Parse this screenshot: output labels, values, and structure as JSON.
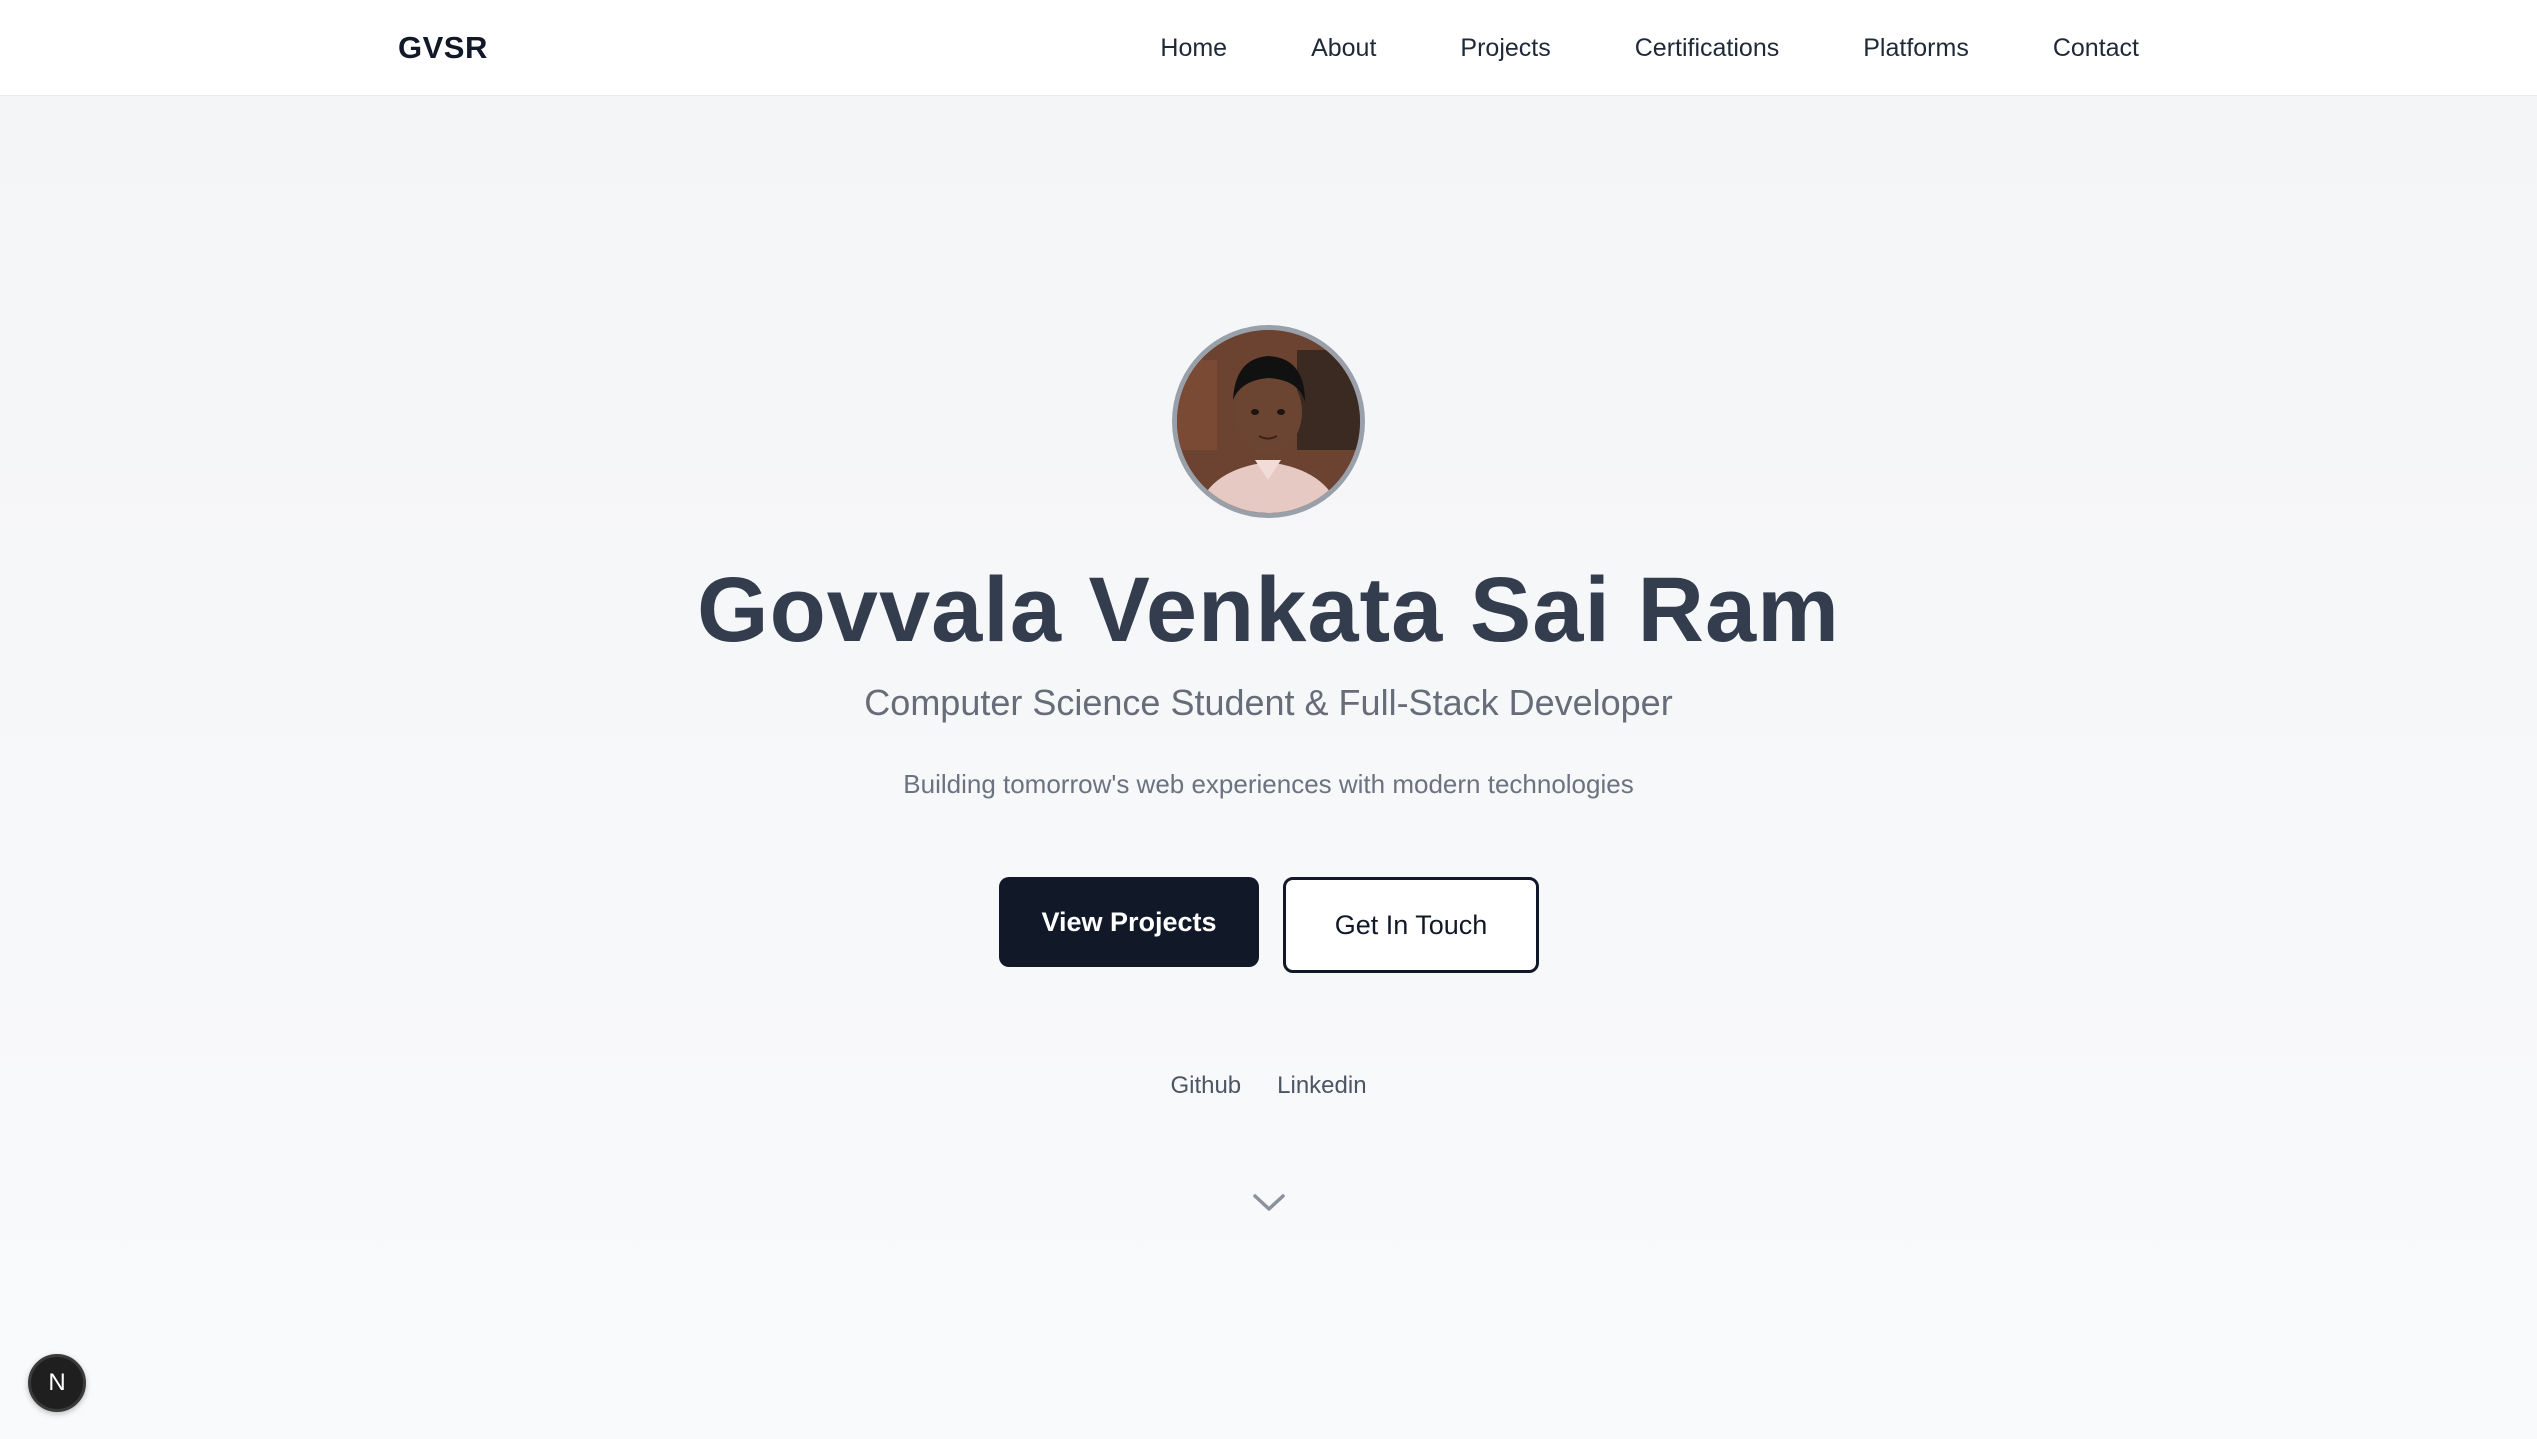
{
  "nav": {
    "brand": "GVSR",
    "links": [
      {
        "label": "Home"
      },
      {
        "label": "About"
      },
      {
        "label": "Projects"
      },
      {
        "label": "Certifications"
      },
      {
        "label": "Platforms"
      },
      {
        "label": "Contact"
      }
    ]
  },
  "hero": {
    "name": "Govvala Venkata Sai Ram",
    "subtitle": "Computer Science Student & Full-Stack Developer",
    "tagline": "Building tomorrow's web experiences with modern technologies",
    "primary_button": "View Projects",
    "secondary_button": "Get In Touch",
    "social_links": [
      "Github",
      "Linkedin"
    ],
    "scroll_icon": "chevron-down-icon",
    "avatar_icon": "profile-photo"
  },
  "dev_badge": {
    "label": "N",
    "icon": "nextjs-icon"
  },
  "colors": {
    "background": "#f6f7f9",
    "heading": "#333d4e",
    "primary_button": "#111827",
    "muted_text": "#6b7280"
  }
}
